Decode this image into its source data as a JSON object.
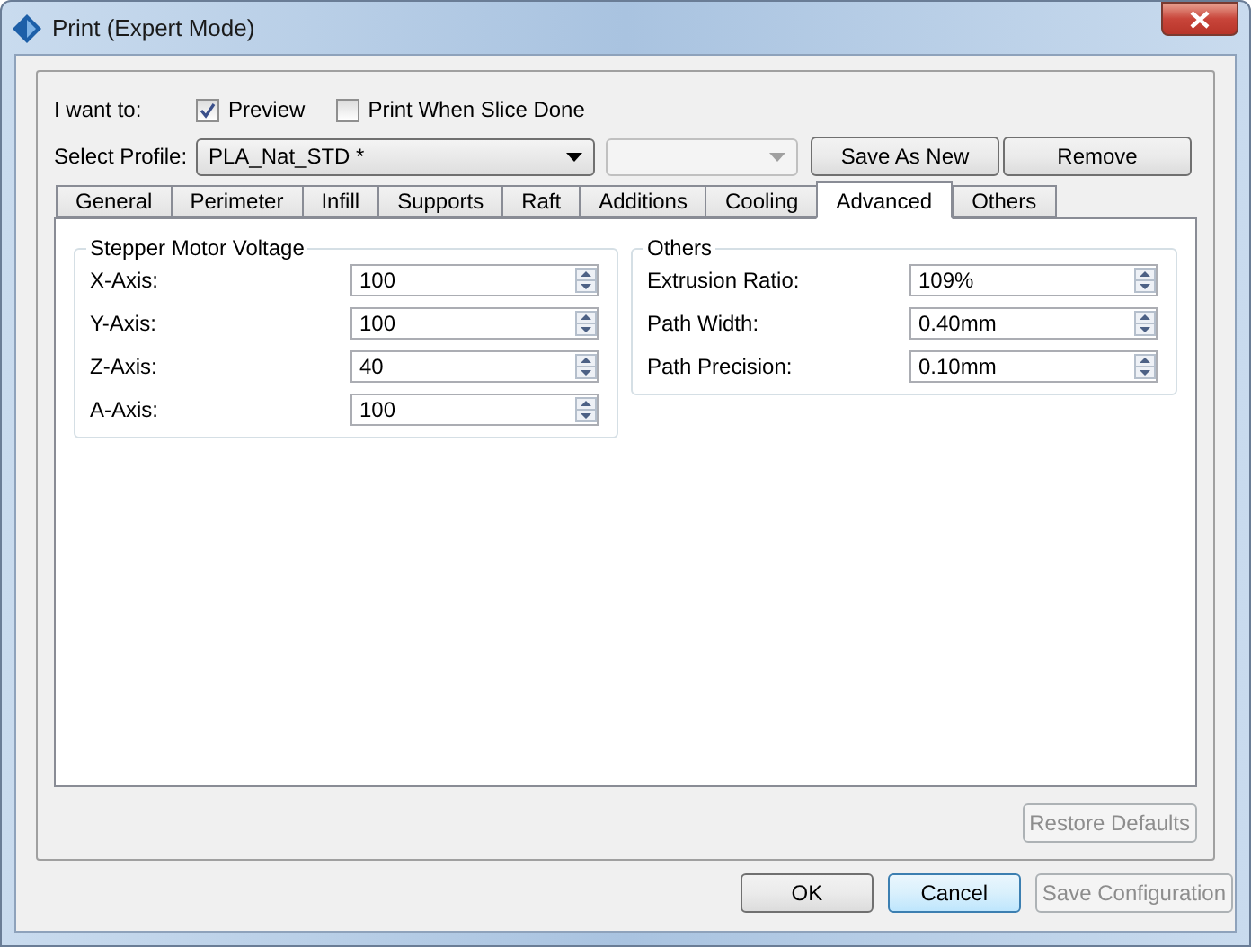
{
  "window": {
    "title": "Print (Expert Mode)"
  },
  "options": {
    "label": "I want to:",
    "checkboxes": [
      {
        "label": "Preview",
        "checked": true
      },
      {
        "label": "Print When Slice Done",
        "checked": false
      }
    ]
  },
  "profile": {
    "label": "Select Profile:",
    "combos": [
      {
        "value": "PLA_Nat_STD *",
        "disabled": false
      },
      {
        "disabled": true
      }
    ],
    "buttons": [
      {
        "label": "Save As New",
        "disabled": false
      },
      {
        "label": "Remove",
        "disabled": false
      }
    ]
  },
  "tabs": [
    {
      "label": "General",
      "selected": false
    },
    {
      "label": "Perimeter",
      "selected": false
    },
    {
      "label": "Infill",
      "selected": false
    },
    {
      "label": "Supports",
      "selected": false
    },
    {
      "label": "Raft",
      "selected": false
    },
    {
      "label": "Additions",
      "selected": false
    },
    {
      "label": "Cooling",
      "selected": false
    },
    {
      "label": "Advanced",
      "selected": true
    },
    {
      "label": "Others",
      "selected": false
    }
  ],
  "groups": [
    {
      "title": "Stepper Motor Voltage",
      "fields": [
        {
          "label": "X-Axis:",
          "value": "100"
        },
        {
          "label": "Y-Axis:",
          "value": "100"
        },
        {
          "label": "Z-Axis:",
          "value": "40"
        },
        {
          "label": "A-Axis:",
          "value": "100"
        }
      ]
    },
    {
      "title": "Others",
      "fields": [
        {
          "label": "Extrusion Ratio:",
          "value": "109%"
        },
        {
          "label": "Path Width:",
          "value": "0.40mm"
        },
        {
          "label": "Path Precision:",
          "value": "0.10mm"
        }
      ]
    }
  ],
  "restore_button": {
    "label": "Restore Defaults",
    "disabled": true
  },
  "footer_buttons": [
    {
      "label": "OK",
      "disabled": false,
      "default": false
    },
    {
      "label": "Cancel",
      "disabled": false,
      "default": true
    },
    {
      "label": "Save Configuration",
      "disabled": true,
      "default": false
    }
  ]
}
